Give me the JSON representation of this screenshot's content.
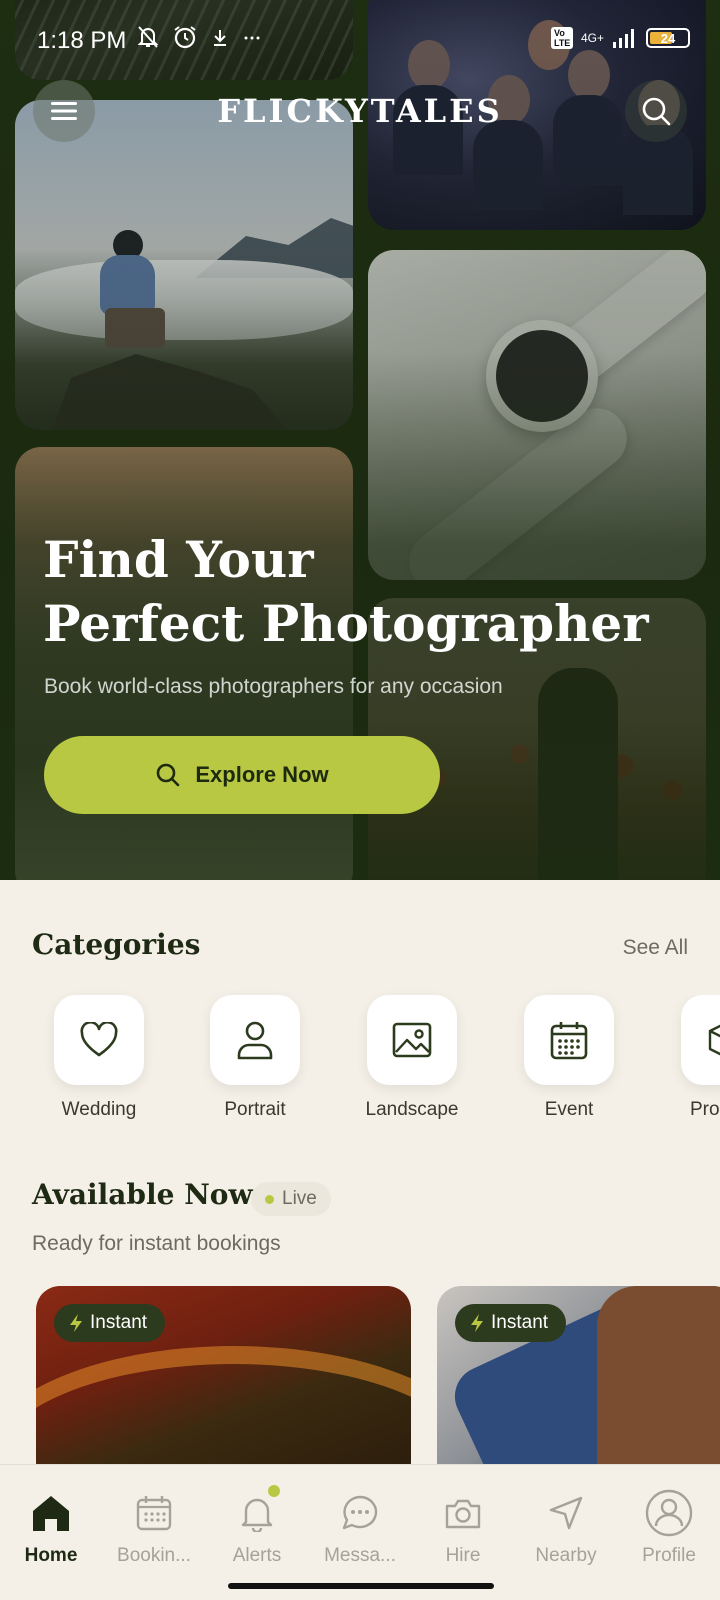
{
  "status_bar": {
    "time": "1:18 PM",
    "network": "4G+",
    "volte": "Vo LTE",
    "battery": "24"
  },
  "header": {
    "brand": "FLICKYTALES"
  },
  "hero": {
    "title_line1": "Find Your",
    "title_line2": "Perfect Photographer",
    "subtitle": "Book world-class photographers for any occasion",
    "cta_label": "Explore Now"
  },
  "categories": {
    "title": "Categories",
    "see_all": "See All",
    "items": [
      {
        "label": "Wedding",
        "icon": "heart-icon"
      },
      {
        "label": "Portrait",
        "icon": "person-icon"
      },
      {
        "label": "Landscape",
        "icon": "image-icon"
      },
      {
        "label": "Event",
        "icon": "calendar-icon"
      },
      {
        "label": "Pro",
        "icon": "box-icon"
      }
    ]
  },
  "available": {
    "title": "Available Now",
    "live_label": "Live",
    "subtitle": "Ready for instant bookings",
    "cards": [
      {
        "badge": "Instant"
      },
      {
        "badge": "Instant"
      }
    ]
  },
  "nav": {
    "items": [
      {
        "label": "Home",
        "icon": "home-icon",
        "active": true
      },
      {
        "label": "Bookin...",
        "icon": "calendar-icon"
      },
      {
        "label": "Alerts",
        "icon": "bell-icon"
      },
      {
        "label": "Messa...",
        "icon": "chat-icon"
      },
      {
        "label": "Hire",
        "icon": "camera-icon"
      },
      {
        "label": "Nearby",
        "icon": "navigation-icon"
      },
      {
        "label": "Profile",
        "icon": "profile-icon"
      }
    ]
  },
  "colors": {
    "hero_bg": "#1f3012",
    "accent": "#b9c843",
    "page_bg": "#f4f0e8",
    "dark_text": "#1f2a14"
  }
}
